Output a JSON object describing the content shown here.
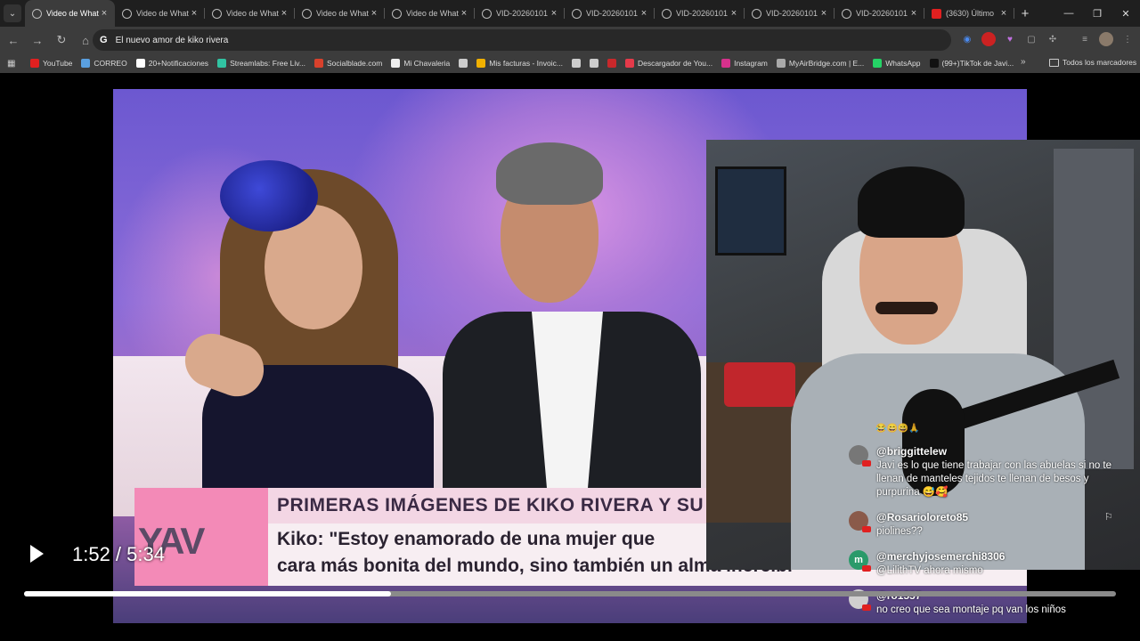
{
  "browser": {
    "tabs": [
      {
        "title": "Video de Whats",
        "active": true
      },
      {
        "title": "Video de Whats",
        "active": false
      },
      {
        "title": "Video de Whats",
        "active": false
      },
      {
        "title": "Video de Whats",
        "active": false
      },
      {
        "title": "Video de Whats",
        "active": false
      },
      {
        "title": "VID-20260101",
        "active": false
      },
      {
        "title": "VID-20260101",
        "active": false
      },
      {
        "title": "VID-20260101",
        "active": false
      },
      {
        "title": "VID-20260101",
        "active": false
      },
      {
        "title": "VID-20260101",
        "active": false
      },
      {
        "title": "(3630) Último",
        "active": false
      }
    ],
    "new_tab": "+",
    "tab_menu": "⌄",
    "window_controls": {
      "minimize": "—",
      "maximize": "❐",
      "close": "✕"
    },
    "nav": {
      "back": "←",
      "forward": "→",
      "reload": "↻",
      "home": "⌂"
    },
    "omnibox": {
      "engine_icon": "G",
      "query": "El nuevo amor de kiko rivera"
    },
    "bookmarks": [
      {
        "label": "YouTube",
        "color": "#e02020"
      },
      {
        "label": "CORREO",
        "color": "#5aa0e0"
      },
      {
        "label": "20+Notificaciones",
        "color": "#ffffff"
      },
      {
        "label": "Streamlabs: Free Liv...",
        "color": "#31c3a2"
      },
      {
        "label": "Socialblade.com",
        "color": "#d8412c"
      },
      {
        "label": "Mi Chavaleria",
        "color": "#eeeeee"
      },
      {
        "label": "",
        "color": "#cccccc"
      },
      {
        "label": "Mis facturas - Invoic...",
        "color": "#f0b000"
      },
      {
        "label": "",
        "color": "#cccccc"
      },
      {
        "label": "",
        "color": "#cccccc"
      },
      {
        "label": "",
        "color": "#c8282b"
      },
      {
        "label": "Descargador de You...",
        "color": "#e53a4a"
      },
      {
        "label": "Instagram",
        "color": "#d6318c"
      },
      {
        "label": "MyAirBridge.com | E...",
        "color": "#aaaaaa"
      },
      {
        "label": "WhatsApp",
        "color": "#25d366"
      },
      {
        "label": "(99+)TikTok de Javi...",
        "color": "#111111"
      }
    ],
    "bookmarks_more": "»",
    "bookmarks_folder": "Todos los marcadores"
  },
  "video": {
    "lower_third": {
      "logo": "YAV",
      "headline": "PRIMERAS IMÁGENES DE KIKO RIVERA Y SU NOV",
      "line1": "Kiko: \"Estoy enamorado de una mujer que",
      "line2": "cara más bonita del mundo, sino también un alma increíbl"
    }
  },
  "chat": {
    "emoji_row": "😂😄😀🙏",
    "messages": [
      {
        "user": "@briggittelew",
        "text": "Javi es lo que tiene trabajar con las abuelas si no te llenan de manteles tejidos te llenan de besos y purpurina 😅🥰",
        "avatar_color": "#777777"
      },
      {
        "user": "@Rosarioloreto85",
        "text": "piolines??",
        "avatar_color": "#8a5a4a"
      },
      {
        "user": "@merchyjosemerchi8306",
        "text": "@LilithTV ahora mismo",
        "avatar_color": "#2a9a6a",
        "avatar_letter": "m"
      },
      {
        "user": "@ro1557",
        "text": "no creo que sea montaje pq van los niños",
        "avatar_color": "#d0cfcf"
      }
    ],
    "flag_icon": "⚐"
  },
  "player": {
    "time_display": "1:52 / 5:34",
    "progress_fraction": 0.336
  }
}
